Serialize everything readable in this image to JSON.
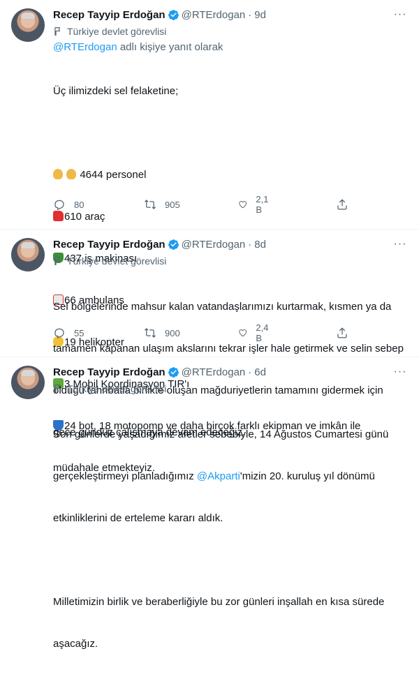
{
  "tweets": [
    {
      "author": "Recep Tayyip Erdoğan",
      "handle": "@RTErdogan",
      "separator": "·",
      "time": "9d",
      "label": "Türkiye devlet görevlisi",
      "reply_to_handle": "@RTErdogan",
      "reply_to_suffix": " adlı kişiye yanıt olarak",
      "lines": {
        "l1": "Üç ilimizdeki sel felaketine;",
        "l2": "4644 personel",
        "l3": "610 araç",
        "l4": "437 iş makinası",
        "l5": "66 ambulans",
        "l6": "19 helikopter",
        "l7": "3 Mobil Koordinasyon TIR'ı",
        "l8": "24 bot, 18 motopomp ve daha birçok farklı ekipman ve imkân ile",
        "l9": "müdahale etmekteyiz."
      },
      "emoji_icons": [
        "woman-worker",
        "man-worker",
        "pickup-truck",
        "tractor",
        "ambulance",
        "helicopter",
        "articulated-lorry",
        "speedboat"
      ],
      "replies": "80",
      "retweets": "905",
      "likes": "2,1 B"
    },
    {
      "author": "Recep Tayyip Erdoğan",
      "handle": "@RTErdogan",
      "separator": "·",
      "time": "8d",
      "label": "Türkiye devlet görevlisi",
      "lines": {
        "l1": "Sel bölgelerinde mahsur kalan vatandaşlarımızı kurtarmak, kısmen ya da",
        "l2": "tamamen kapanan ulaşım akslarını tekrar işler hale getirmek ve selin sebep",
        "l3": "olduğu tahribatla birlikte oluşan mağduriyetlerin tamamını gidermek için",
        "l4": "gece gündüz çalışmaya devam edeceğiz."
      },
      "replies": "55",
      "retweets": "900",
      "likes": "2,4 B"
    },
    {
      "author": "Recep Tayyip Erdoğan",
      "handle": "@RTErdogan",
      "separator": "·",
      "time": "6d",
      "label": "Türkiye devlet görevlisi",
      "lines": {
        "l1": "Son günlerde yaşadığımız afetler sebebiyle, 14 Ağustos Cumartesi günü",
        "l2a": "gerçekleştirmeyi planladığımız ",
        "l2link": "@Akparti",
        "l2b": "'mizin 20. kuruluş yıl dönümü",
        "l3": "etkinliklerini de erteleme kararı aldık.",
        "l5": "Milletimizin birlik ve beraberliğiyle bu zor günleri inşallah en kısa sürede",
        "l6": "aşacağız."
      }
    }
  ],
  "colors": {
    "link": "#1d9bf0",
    "muted": "#536471",
    "text": "#0f1419",
    "verified": "#1d9bf0"
  },
  "icons": [
    "verified-badge-icon",
    "flag-icon",
    "reply-icon",
    "retweet-icon",
    "like-icon",
    "share-icon",
    "more-icon"
  ]
}
